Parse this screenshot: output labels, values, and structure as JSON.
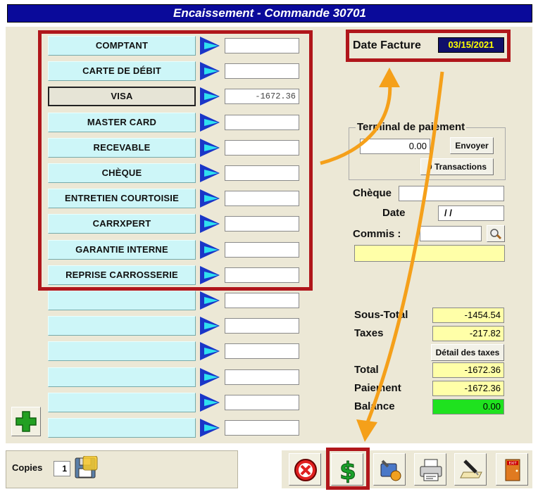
{
  "window": {
    "title": "Encaissement - Commande 30701"
  },
  "payments": [
    {
      "label": "COMPTANT",
      "amount": ""
    },
    {
      "label": "CARTE DE DÉBIT",
      "amount": ""
    },
    {
      "label": "VISA",
      "amount": "-1672.36"
    },
    {
      "label": "MASTER CARD",
      "amount": ""
    },
    {
      "label": "RECEVABLE",
      "amount": ""
    },
    {
      "label": "CHÈQUE",
      "amount": ""
    },
    {
      "label": "ENTRETIEN COURTOISIE",
      "amount": ""
    },
    {
      "label": "CARRXPERT",
      "amount": ""
    },
    {
      "label": "GARANTIE INTERNE",
      "amount": ""
    },
    {
      "label": "REPRISE CARROSSERIE",
      "amount": ""
    },
    {
      "label": "",
      "amount": ""
    },
    {
      "label": "",
      "amount": ""
    },
    {
      "label": "",
      "amount": ""
    },
    {
      "label": "",
      "amount": ""
    },
    {
      "label": "",
      "amount": ""
    },
    {
      "label": "",
      "amount": ""
    }
  ],
  "date_facture": {
    "label": "Date Facture",
    "value": "03/15/2021"
  },
  "terminal": {
    "legend": "Terminal de paiement",
    "amount": "0.00",
    "send_label": "Envoyer",
    "transactions_label": "0 Transactions"
  },
  "cheque": {
    "label": "Chèque",
    "value": ""
  },
  "date": {
    "label": "Date",
    "value": " / /"
  },
  "commis": {
    "label": "Commis :",
    "value": "",
    "name": ""
  },
  "totals": {
    "sous_total_label": "Sous-Total",
    "sous_total": "-1454.54",
    "taxes_label": "Taxes",
    "taxes": "-217.82",
    "detail_taxes_label": "Détail des taxes",
    "total_label": "Total",
    "total": "-1672.36",
    "paiement_label": "Paiement",
    "paiement": "-1672.36",
    "balance_label": "Balance",
    "balance": "0.00"
  },
  "copies": {
    "label": "Copies",
    "value": "1"
  },
  "colors": {
    "title_bar": "#0a0a9a",
    "highlight": "#b0161b",
    "annotation_arrow": "#f5a01a",
    "balance_ok": "#1fe21f"
  },
  "icons": [
    "triangle-arrow-icon",
    "add-plus-icon",
    "floppy-save-icon",
    "cancel-icon",
    "dollar-icon",
    "tools-icon",
    "printer-icon",
    "signature-icon",
    "exit-door-icon",
    "magnifier-icon"
  ]
}
